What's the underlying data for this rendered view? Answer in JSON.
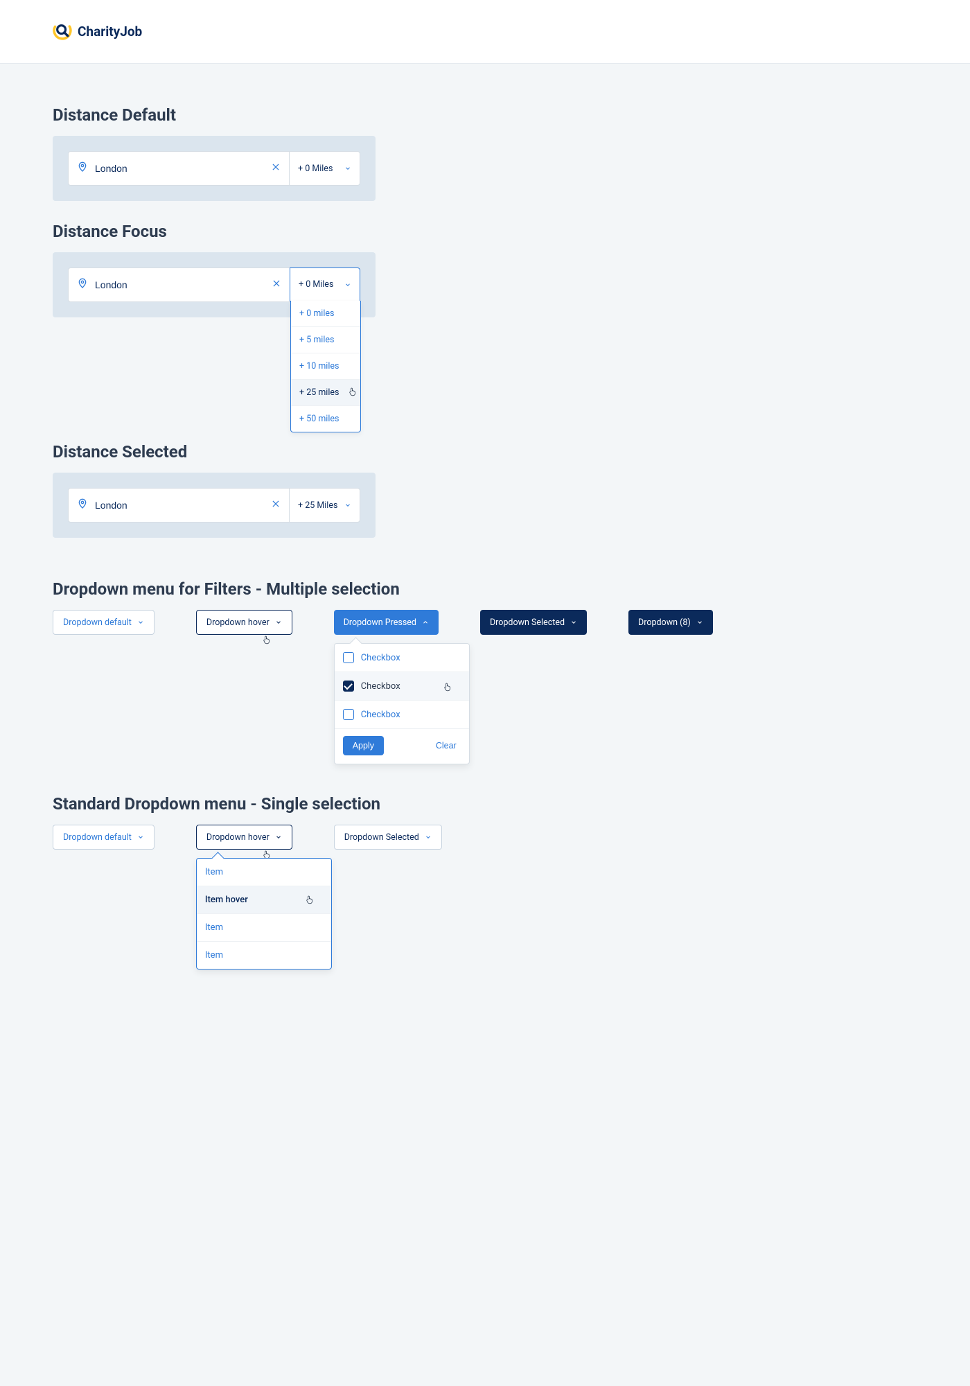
{
  "logo": {
    "text": "CharityJob"
  },
  "sections": {
    "distance_default": {
      "title": "Distance Default",
      "location": "London",
      "miles": "+ 0 Miles"
    },
    "distance_focus": {
      "title": "Distance Focus",
      "location": "London",
      "miles_label": "+ 0 Miles",
      "options": [
        "+ 0 miles",
        "+ 5 miles",
        "+ 10 miles",
        "+ 25 miles",
        "+ 50 miles"
      ],
      "hover_index": 3
    },
    "distance_selected": {
      "title": "Distance Selected",
      "location": "London",
      "miles": "+ 25 Miles"
    },
    "filters_multi": {
      "title": "Dropdown menu for Filters - Multiple selection",
      "buttons": {
        "default": "Dropdown default",
        "hover": "Dropdown hover",
        "pressed": "Dropdown Pressed",
        "selected": "Dropdown Selected",
        "count": "Dropdown (8)"
      },
      "popover": {
        "items": [
          {
            "label": "Checkbox",
            "checked": false
          },
          {
            "label": "Checkbox",
            "checked": true,
            "hover": true
          },
          {
            "label": "Checkbox",
            "checked": false
          }
        ],
        "apply": "Apply",
        "clear": "Clear"
      }
    },
    "single": {
      "title": "Standard Dropdown menu - Single selection",
      "buttons": {
        "default": "Dropdown default",
        "hover": "Dropdown hover",
        "selected": "Dropdown Selected"
      },
      "popover": {
        "items": [
          "Item",
          "Item hover",
          "Item",
          "Item"
        ],
        "hover_index": 1
      }
    }
  }
}
